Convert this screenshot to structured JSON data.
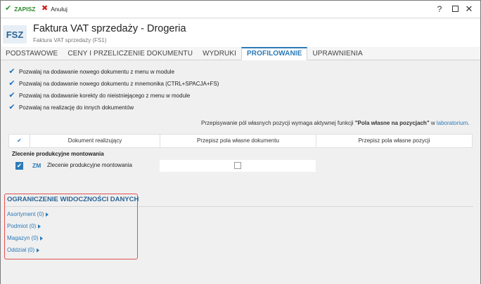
{
  "toolbar": {
    "save_label": "ZAPISZ",
    "cancel_label": "Anuluj"
  },
  "window_controls": {
    "help": "?",
    "close": "✕"
  },
  "header": {
    "badge": "FSZ",
    "title": "Faktura VAT sprzedaży - Drogeria",
    "subtitle": "Faktura VAT sprzedaży (FS1)"
  },
  "tabs": [
    {
      "label": "PODSTAWOWE"
    },
    {
      "label": "CENY I PRZELICZENIE DOKUMENTU"
    },
    {
      "label": "WYDRUKI"
    },
    {
      "label": "PROFILOWANIE",
      "active": true
    },
    {
      "label": "UPRAWNIENIA"
    }
  ],
  "options": [
    {
      "label": "Pozwalaj na dodawanie nowego dokumentu z menu w module",
      "checked": true
    },
    {
      "label": "Pozwalaj na dodawanie nowego dokumentu z mnemonika (CTRL+SPACJA+FS)",
      "checked": true
    },
    {
      "label": "Pozwalaj na dodawanie korekty do nieistniejącego z menu w module",
      "checked": true
    },
    {
      "label": "Pozwalaj na realizację do innych dokumentów",
      "checked": true
    }
  ],
  "note": {
    "prefix": "Przepisywanie pól własnych pozycji wymaga aktywnej funkcji ",
    "bold": "\"Pola własne na pozycjach\"",
    "mid": " w ",
    "link": "laboratorium",
    "suffix": "."
  },
  "grid": {
    "headers": {
      "check": "✔",
      "col1": "Dokument realizujący",
      "col2": "Przepisz pola własne dokumentu",
      "col3": "Przepisz pola własne pozycji"
    },
    "group_label": "Zlecenie produkcyjne montowania",
    "rows": [
      {
        "code": "ZM",
        "name": "Zlecenie produkcyjne montowania",
        "checked": true
      }
    ]
  },
  "visibility": {
    "title": "OGRANICZENIE WIDOCZNOŚCI DANYCH",
    "filters": [
      {
        "label": "Asortyment (0)"
      },
      {
        "label": "Podmiot (0)"
      },
      {
        "label": "Magazyn (0)"
      },
      {
        "label": "Oddział (0)"
      }
    ]
  },
  "colors": {
    "accent": "#2a7ab8",
    "save_green": "#2b8a2b",
    "cancel_red": "#d42020",
    "highlight_border": "#e05050"
  }
}
